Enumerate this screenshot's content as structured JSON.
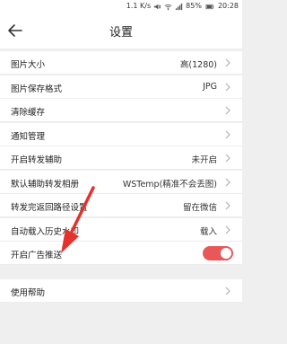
{
  "status_bar": {
    "speed": "1.1 K/s",
    "battery": "85%",
    "time": "20:28"
  },
  "header": {
    "title": "设置"
  },
  "settings": {
    "image_size": {
      "label": "图片大小",
      "value": "高(1280)"
    },
    "image_format": {
      "label": "图片保存格式",
      "value": "JPG"
    },
    "clear_cache": {
      "label": "清除缓存"
    },
    "notifications": {
      "label": "通知管理"
    },
    "forward_assist": {
      "label": "开启转发辅助",
      "value": "未开启"
    },
    "default_album": {
      "label": "默认辅助转发相册",
      "value": "WSTemp(精准不会丢图)"
    },
    "return_path": {
      "label": "转发完返回路径设置",
      "value": "留在微信"
    },
    "auto_watermark": {
      "label": "自动载入历史水印",
      "value": "载入"
    },
    "ad_push": {
      "label": "开启广告推送",
      "enabled": true
    }
  },
  "help": {
    "label": "使用帮助"
  },
  "colors": {
    "toggle_on": "#e8585a",
    "annotation_arrow": "#e5322d"
  }
}
